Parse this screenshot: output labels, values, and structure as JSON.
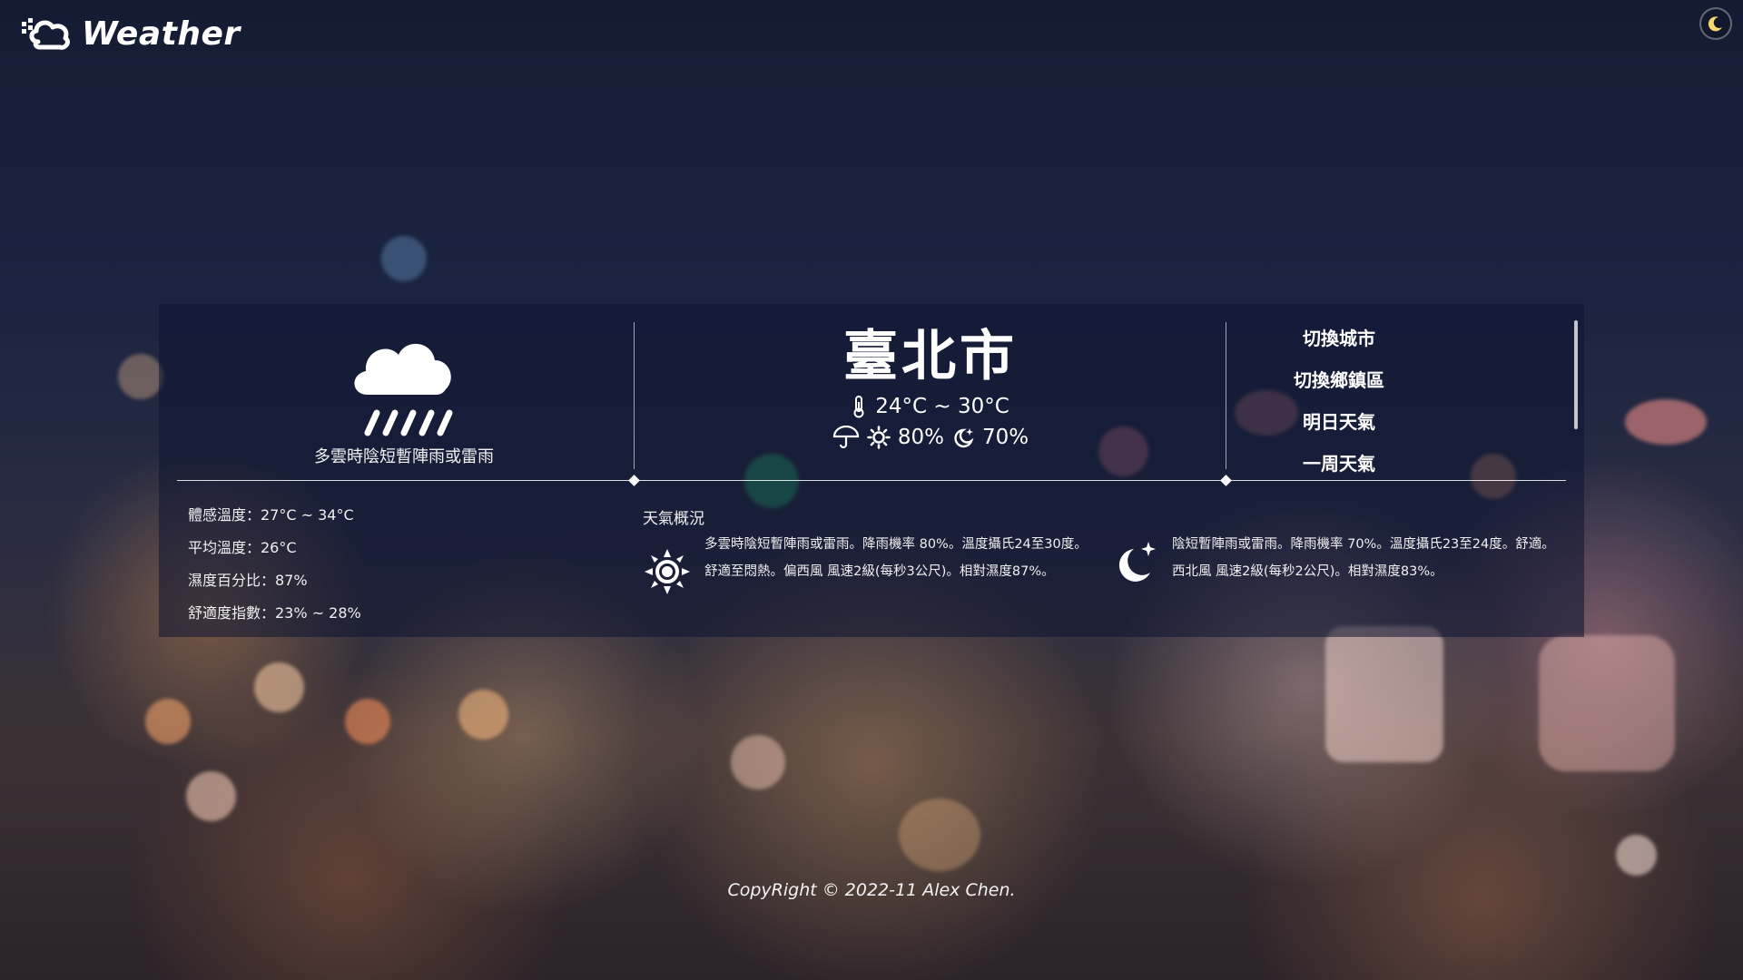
{
  "header": {
    "logo_text": "Weather",
    "theme_icon": "moon-icon"
  },
  "current": {
    "icon": "cloud-rain-icon",
    "description": "多雲時陰短暫陣雨或雷雨"
  },
  "city": {
    "name": "臺北市",
    "temp_range": "24°C ~ 30°C",
    "rain_day": "80%",
    "rain_night": "70%"
  },
  "menu": {
    "items": [
      {
        "label": "切換城市"
      },
      {
        "label": "切換鄉鎮區"
      },
      {
        "label": "明日天氣"
      },
      {
        "label": "一周天氣"
      }
    ]
  },
  "stats": [
    {
      "text": "體感溫度：27°C ~ 34°C"
    },
    {
      "text": "平均溫度：26°C"
    },
    {
      "text": "濕度百分比：87%"
    },
    {
      "text": "舒適度指數：23% ~ 28%"
    }
  ],
  "overview": {
    "title": "天氣概況",
    "day_text": "多雲時陰短暫陣雨或雷雨。降雨機率 80%。溫度攝氏24至30度。舒適至悶熱。偏西風 風速2級(每秒3公尺)。相對濕度87%。",
    "night_text": "陰短暫陣雨或雷雨。降雨機率 70%。溫度攝氏23至24度。舒適。西北風 風速2級(每秒2公尺)。相對濕度83%。"
  },
  "footer": {
    "copyright": "CopyRight © 2022-11 Alex Chen."
  }
}
